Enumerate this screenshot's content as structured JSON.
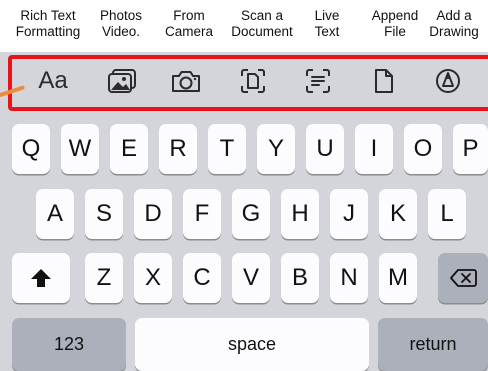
{
  "captions": [
    {
      "label": "Rich Text\nFormatting"
    },
    {
      "label": "Photos\nVideo."
    },
    {
      "label": "From\nCamera"
    },
    {
      "label": "Scan a\nDocument"
    },
    {
      "label": "Live\nText"
    },
    {
      "label": "Append\nFile"
    },
    {
      "label": "Add a\nDrawing"
    }
  ],
  "toolbar": {
    "text_format_label": "Aa",
    "icons": [
      "text-format-icon",
      "photo-library-icon",
      "camera-icon",
      "scan-document-icon",
      "live-text-icon",
      "file-icon",
      "markup-pen-icon"
    ]
  },
  "keyboard": {
    "row1": [
      "Q",
      "W",
      "E",
      "R",
      "T",
      "Y",
      "U",
      "I",
      "O",
      "P"
    ],
    "row2": [
      "A",
      "S",
      "D",
      "F",
      "G",
      "H",
      "J",
      "K",
      "L"
    ],
    "row3": [
      "Z",
      "X",
      "C",
      "V",
      "B",
      "N",
      "M"
    ],
    "numbers_label": "123",
    "space_label": "space",
    "return_label": "return"
  },
  "colors": {
    "highlight": "#e8131b",
    "keyboard_bg": "#d3d5db",
    "key_bg": "#fcfcfe",
    "key_dark_bg": "#abb0ba",
    "pointer": "#f08a3c"
  }
}
